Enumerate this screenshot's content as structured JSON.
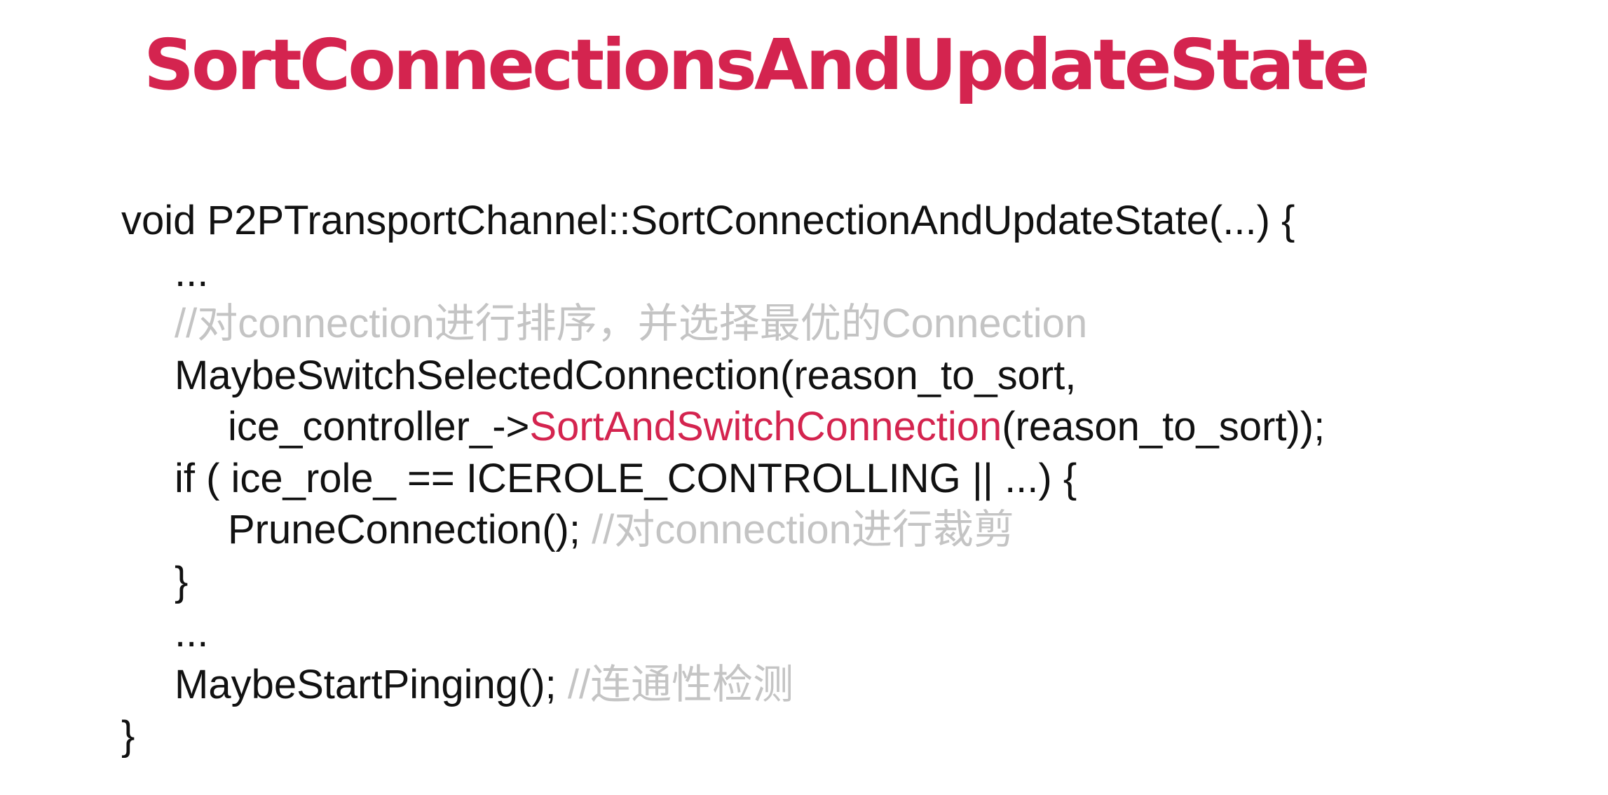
{
  "slide": {
    "title": "SortConnectionsAndUpdateState"
  },
  "code": {
    "l1": "void P2PTransportChannel::SortConnectionAndUpdateState(...) {",
    "l2": "...",
    "l3_comment": "//对connection进行排序，并选择最优的Connection",
    "l4": "MaybeSwitchSelectedConnection(reason_to_sort,",
    "l5_pre": "ice_controller_->",
    "l5_highlight": "SortAndSwitchConnection",
    "l5_post": "(reason_to_sort));",
    "l6": "if ( ice_role_ == ICEROLE_CONTROLLING || ...) {",
    "l7_code": "PruneConnection(); ",
    "l7_comment": "//对connection进行裁剪",
    "l8": "}",
    "l9": "...",
    "l10_code": "MaybeStartPinging(); ",
    "l10_comment": "//连通性检测",
    "l11": "}"
  },
  "colors": {
    "accent": "#d4244f",
    "comment": "#c4c4c4",
    "text": "#111111",
    "background": "#ffffff"
  }
}
